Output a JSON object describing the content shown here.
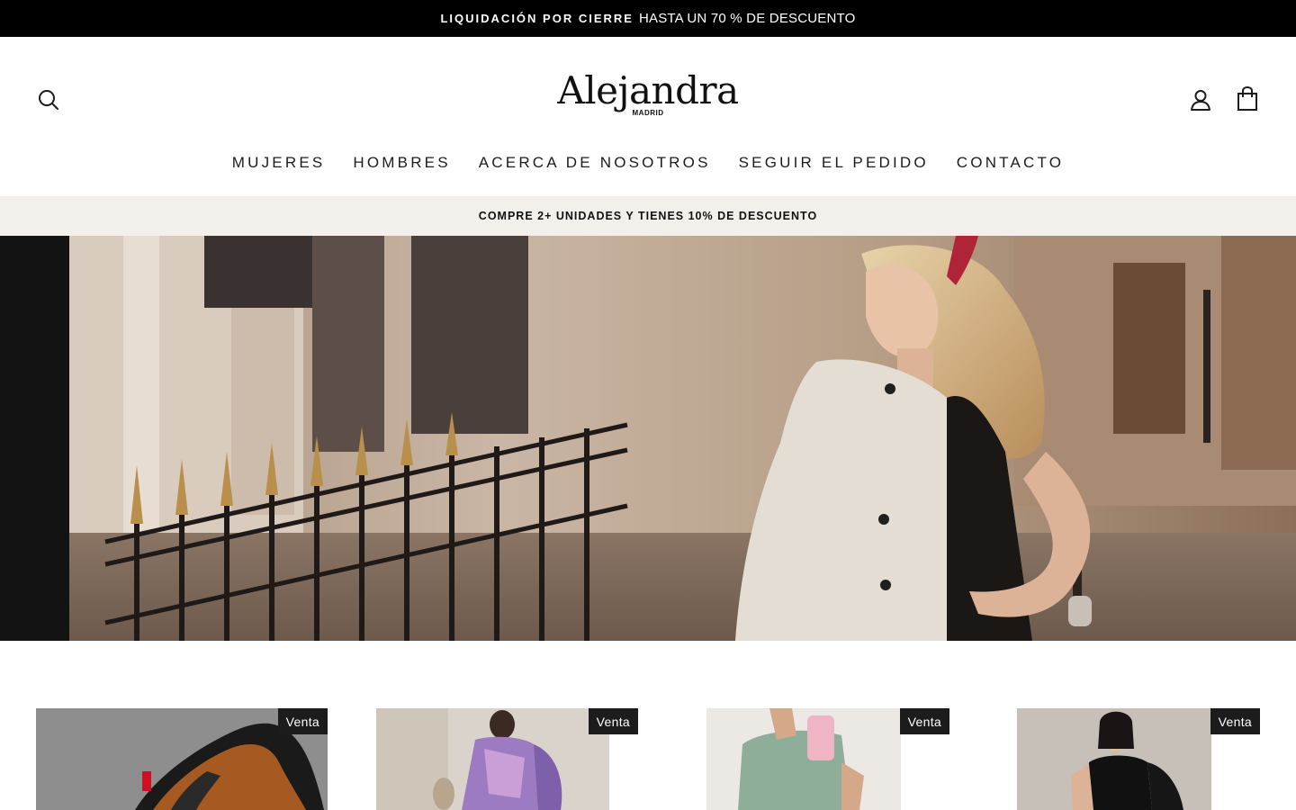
{
  "announcement": {
    "bold_text": "LIQUIDACIÓN POR CIERRE",
    "text": "HASTA UN 70 % DE DESCUENTO"
  },
  "header": {
    "logo_main": "Alejandra",
    "logo_sub": "MADRID",
    "icons": [
      "search-icon",
      "account-icon",
      "cart-icon"
    ]
  },
  "nav": {
    "items": [
      {
        "label": "MUJERES"
      },
      {
        "label": "HOMBRES"
      },
      {
        "label": "ACERCA DE NOSOTROS"
      },
      {
        "label": "SEGUIR EL PEDIDO"
      },
      {
        "label": "CONTACTO"
      }
    ]
  },
  "promo": {
    "text": "COMPRE 2+ UNIDADES Y TIENES 10% DE DESCUENTO"
  },
  "products": [
    {
      "badge": "Venta"
    },
    {
      "badge": "Venta"
    },
    {
      "badge": "Venta"
    },
    {
      "badge": "Venta"
    }
  ],
  "colors": {
    "announcement_bg": "#000000",
    "promo_bg": "#f3efea",
    "badge_bg": "#1c1c1c",
    "text": "#1c1c1c"
  }
}
